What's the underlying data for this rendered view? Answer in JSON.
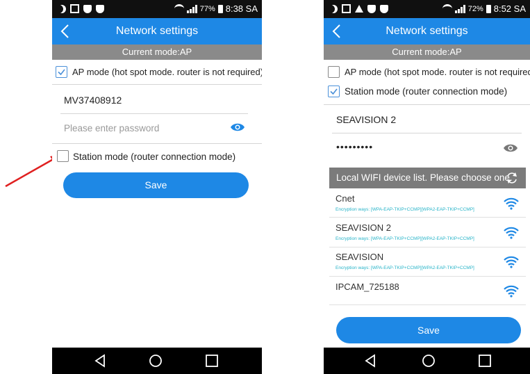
{
  "left_screen": {
    "status": {
      "battery_pct": "77%",
      "time": "8:38 SA"
    },
    "app_title": "Network settings",
    "current_mode": "Current mode:AP",
    "ap_mode_label": "AP mode (hot spot mode. router is not required)",
    "ap_checked": true,
    "ssid_value": "MV37408912",
    "password_placeholder": "Please enter password",
    "station_mode_label": "Station mode (router connection mode)",
    "station_checked": false,
    "save_label": "Save"
  },
  "right_screen": {
    "status": {
      "battery_pct": "72%",
      "time": "8:52 SA"
    },
    "app_title": "Network settings",
    "current_mode": "Current mode:AP",
    "ap_mode_label": "AP mode (hot spot mode. router is not required)",
    "ap_checked": false,
    "station_mode_label": "Station mode (router connection mode)",
    "station_checked": true,
    "ssid_value": "SEAVISION 2",
    "password_masked": "•••••••••",
    "wifi_list_title": "Local WIFI device list. Please choose one.",
    "wifi_list": [
      {
        "name": "Cnet",
        "encryption": "Encryption ways:  [WPA-EAP-TKIP+CCMP][WPA2-EAP-TKIP+CCMP]"
      },
      {
        "name": "SEAVISION 2",
        "encryption": "Encryption ways:  [WPA-EAP-TKIP+CCMP][WPA2-EAP-TKIP+CCMP]"
      },
      {
        "name": "SEAVISION",
        "encryption": "Encryption ways:  [WPA-EAP-TKIP+CCMP][WPA2-EAP-TKIP+CCMP]"
      },
      {
        "name": "IPCAM_725188",
        "encryption": ""
      }
    ],
    "save_label": "Save"
  },
  "colors": {
    "app_bar": "#1e88e5",
    "mode_bar": "#8a8a8a",
    "list_header": "#7b7b7b",
    "encryption_text": "#25b3c8",
    "annotation_arrow": "#e02020"
  },
  "icons": {
    "back": "chevron-left-icon",
    "eye": "eye-icon",
    "refresh": "refresh-icon",
    "wifi": "wifi-signal-icon",
    "nav_back": "triangle-back-icon",
    "nav_home": "circle-home-icon",
    "nav_recent": "square-recent-icon"
  }
}
